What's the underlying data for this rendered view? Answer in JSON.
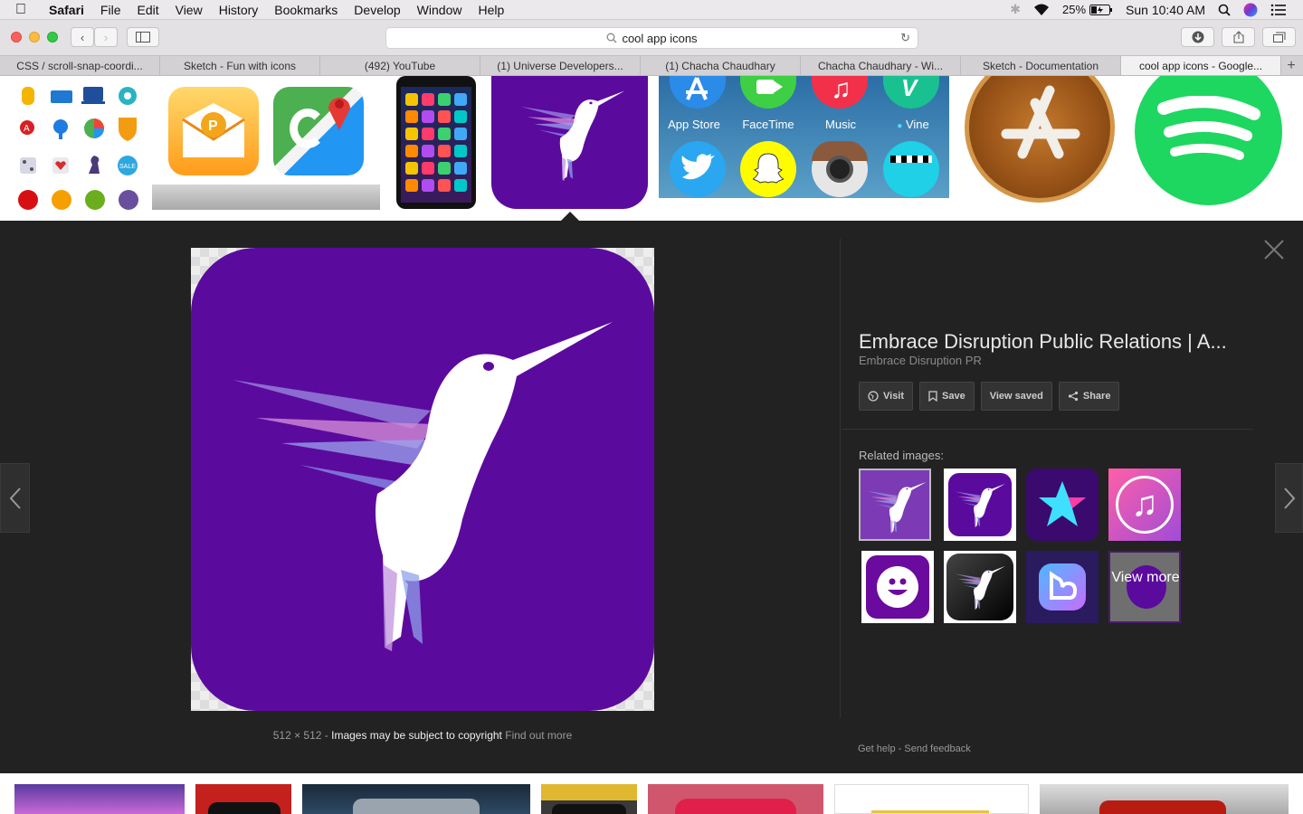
{
  "menubar": {
    "app": "Safari",
    "items": [
      "File",
      "Edit",
      "View",
      "History",
      "Bookmarks",
      "Develop",
      "Window",
      "Help"
    ],
    "battery": "25%",
    "clock": "Sun 10:40 AM"
  },
  "toolbar": {
    "url": "cool app icons"
  },
  "tabs": [
    {
      "label": "CSS / scroll-snap-coordi..."
    },
    {
      "label": "Sketch - Fun with icons"
    },
    {
      "label": "(492) YouTube"
    },
    {
      "label": "(1) Universe Developers..."
    },
    {
      "label": "(1) Chacha Chaudhary"
    },
    {
      "label": "Chacha Chaudhary - Wi..."
    },
    {
      "label": "Sketch - Documentation"
    },
    {
      "label": "cool app icons - Google..."
    }
  ],
  "strip": {
    "apps": {
      "appstore": "App Store",
      "facetime": "FaceTime",
      "music": "Music",
      "vine": "Vine"
    }
  },
  "detail": {
    "title": "Embrace Disruption Public Relations | A...",
    "source": "Embrace Disruption PR",
    "buttons": {
      "visit": "Visit",
      "save": "Save",
      "view_saved": "View saved",
      "share": "Share"
    },
    "related_label": "Related images:",
    "view_more": "View more",
    "size": "512 × 512",
    "copyright": "Images may be subject to copyright",
    "find_out_more": "Find out more",
    "get_help": "Get help",
    "send_feedback": "Send feedback",
    "sep": "-"
  },
  "colors": {
    "purple": "#5b0a9e",
    "panel_bg": "#222222"
  }
}
